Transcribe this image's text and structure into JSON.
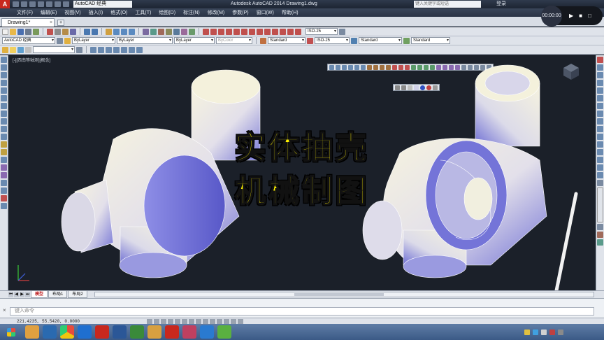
{
  "titlebar": {
    "logo": "A",
    "workspace": "AutoCAD 经典",
    "title": "Autodesk AutoCAD 2014    Drawing1.dwg",
    "search_placeholder": "键入关键字或短语",
    "login": "登录"
  },
  "menu": [
    "文件(F)",
    "编辑(E)",
    "视图(V)",
    "插入(I)",
    "格式(O)",
    "工具(T)",
    "绘图(D)",
    "标注(N)",
    "修改(M)",
    "参数(P)",
    "窗口(W)",
    "帮助(H)"
  ],
  "tabs": {
    "doc": "Drawing1*",
    "close": "×",
    "add": "+"
  },
  "toolbar2": {
    "workspace": "AutoCAD 经典",
    "layer_color": "ByLayer",
    "linetype": "ByLayer",
    "lineweight": "ByLayer",
    "plotstyle": "ByColor",
    "text_style": "Standard",
    "dim_style": "ISO-25",
    "table_style": "Standard",
    "mleader_style": "Standard"
  },
  "toolbar1": {
    "dim_style": "ISO-25"
  },
  "canvas": {
    "viewport_label": "[-][西南等轴测][概念]",
    "overlay_line1": "实体抽壳",
    "overlay_line2": "机械制图"
  },
  "layout_tabs": [
    "模型",
    "布局1",
    "布局2"
  ],
  "command": {
    "close": "×",
    "placeholder": "键入命令"
  },
  "status": {
    "coords": "221.4235, 55.5420, 0.0000"
  },
  "recorder": {
    "time": "00:00:00",
    "play": "▶",
    "stop": "■",
    "exit": "□"
  },
  "colors": {
    "accent_title": "#fff200",
    "canvas_bg": "#1b2029",
    "solid_light": "#f4f1dc",
    "solid_shade": "#6f6fd6"
  }
}
